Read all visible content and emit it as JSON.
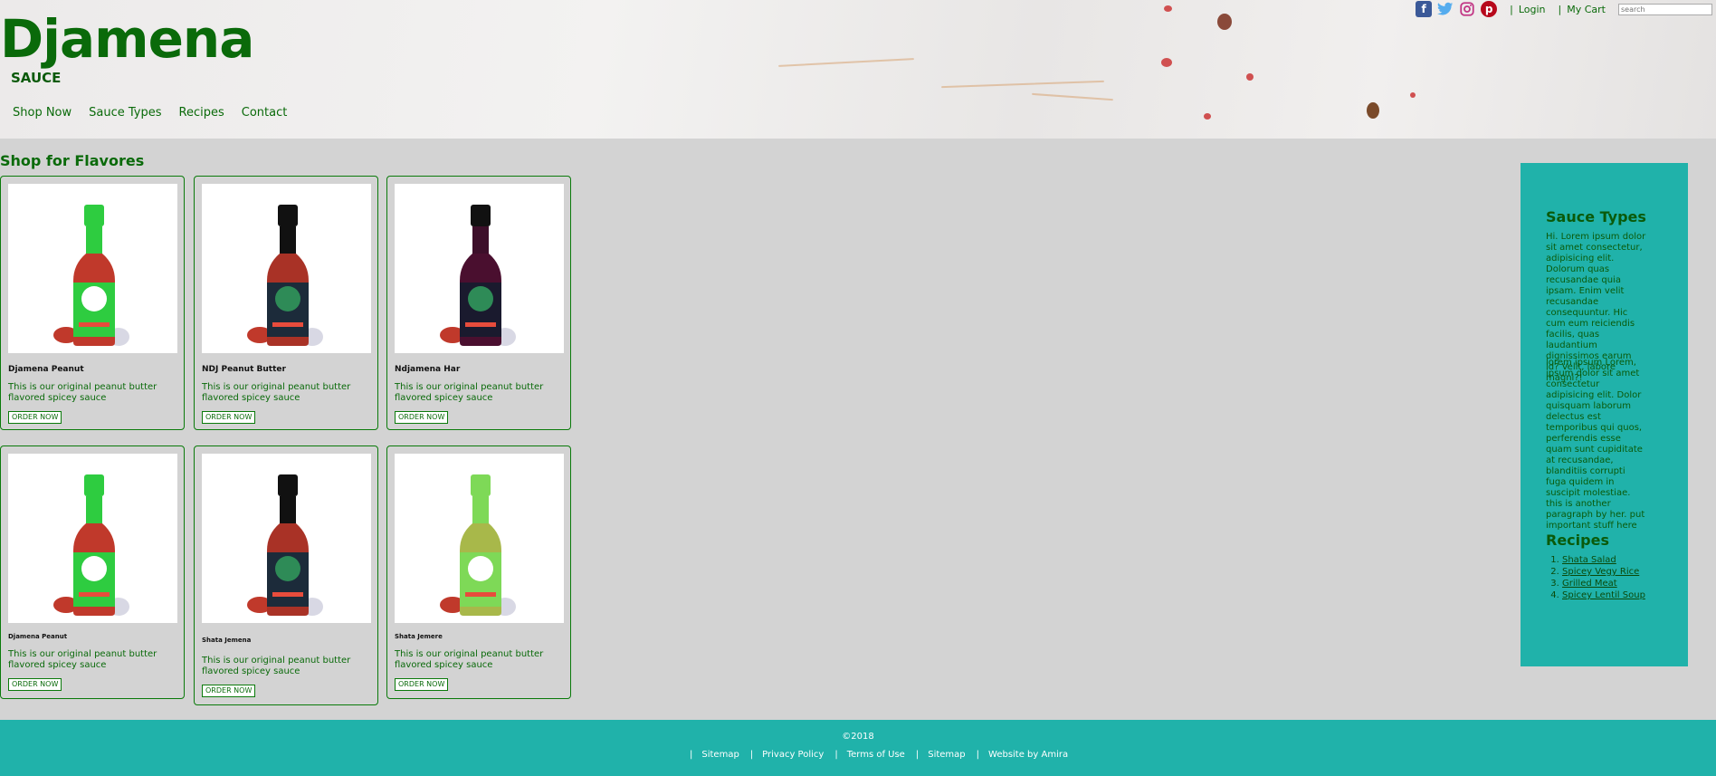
{
  "brand": {
    "title": "Djamena",
    "subtitle": "SAUCE"
  },
  "nav": [
    "Shop Now",
    "Sauce Types",
    "Recipes",
    "Contact"
  ],
  "topbar": {
    "social": [
      "facebook-icon",
      "twitter-icon",
      "instagram-icon",
      "pinterest-icon"
    ],
    "login": "Login",
    "cart": "My Cart",
    "search_placeholder": "search"
  },
  "main": {
    "title": "Shop for Flavores",
    "products": [
      {
        "name": "Djamena Peanut",
        "desc": "This is our original peanut butter flavored spicey sauce",
        "button": "ORDER NOW",
        "bottle": "green"
      },
      {
        "name": "NDJ Peanut Butter",
        "desc": "This is our original peanut butter flavored spicey sauce",
        "button": "ORDER NOW",
        "bottle": "crimson"
      },
      {
        "name": "Ndjamena Har",
        "desc": "This is our original peanut butter flavored spicey sauce",
        "button": "ORDER NOW",
        "bottle": "purple"
      },
      {
        "name": "Djamena Peanut",
        "desc": "This is our original peanut butter flavored spicey sauce",
        "button": "ORDER NOW",
        "bottle": "green"
      },
      {
        "name": "Shata Jemena",
        "desc": "This is our original peanut butter flavored spicey sauce",
        "button": "ORDER NOW",
        "bottle": "crimson"
      },
      {
        "name": "Shata Jemere",
        "desc": "This is our original peanut butter flavored spicey sauce",
        "button": "ORDER NOW",
        "bottle": "lime"
      }
    ]
  },
  "sidebar": {
    "sauce_title": "Sauce Types",
    "para1": "Hi. Lorem ipsum dolor sit amet consectetur, adipisicing elit. Dolorum quas recusandae quia ipsam. Enim velit recusandae consequuntur. Hic cum eum reiciendis facilis, quas laudantium dignissimos earum id? Velit, labore magni?!",
    "para2": "lorem ipsum Lorem, ipsum dolor sit amet consectetur adipisicing elit. Dolor quisquam laborum delectus est temporibus qui quos, perferendis esse quam sunt cupiditate at recusandae, blanditiis corrupti fuga quidem in suscipit molestiae. this is another paragraph by her. put important stuff here",
    "recipes_title": "Recipes",
    "recipes": [
      "Shata Salad",
      "Spicey Vegy Rice",
      "Grilled Meat",
      "Spicey Lentil Soup"
    ]
  },
  "footer": {
    "copyright": "©2018",
    "links": [
      "Sitemap",
      "Privacy Policy",
      "Terms of Use",
      "Sitemap",
      "Website by Amira"
    ]
  },
  "colors": {
    "brand_green": "#0a6a0a",
    "teal": "#20b2aa",
    "page_bg": "#d3d3d3"
  }
}
